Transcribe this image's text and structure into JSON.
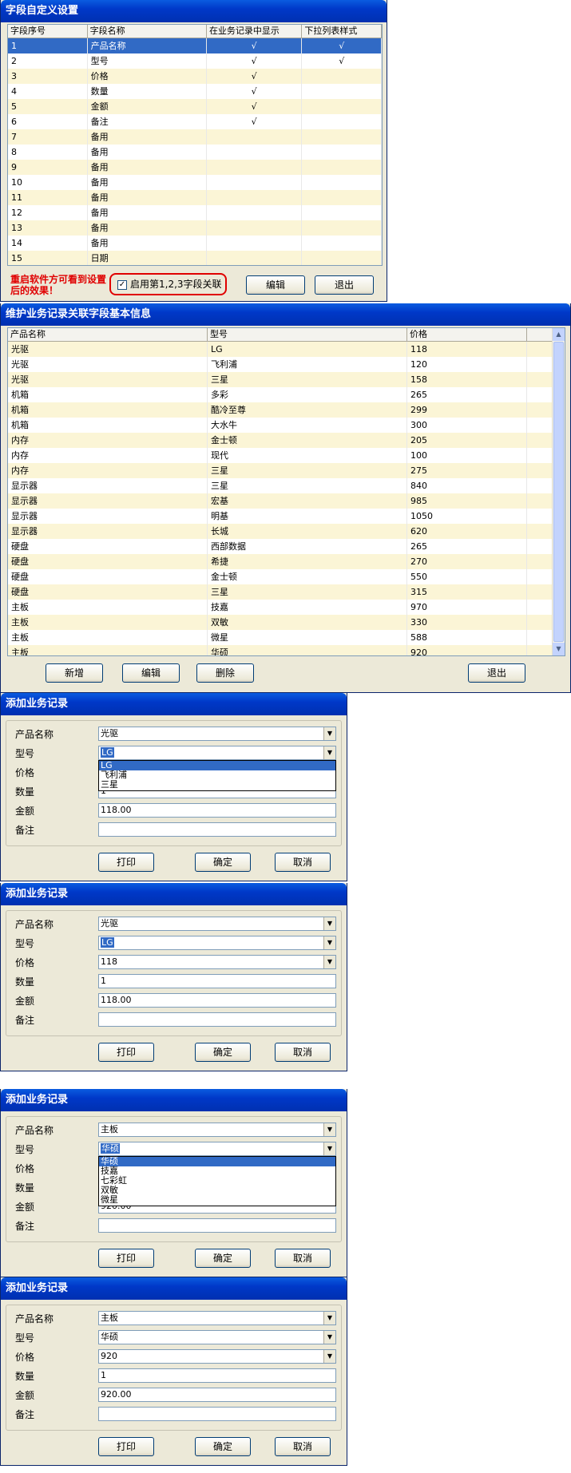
{
  "win1": {
    "title": "字段自定义设置",
    "headers": [
      "字段序号",
      "字段名称",
      "在业务记录中显示",
      "下拉列表样式"
    ],
    "rows": [
      [
        "1",
        "产品名称",
        "√",
        "√"
      ],
      [
        "2",
        "型号",
        "√",
        "√"
      ],
      [
        "3",
        "价格",
        "√",
        ""
      ],
      [
        "4",
        "数量",
        "√",
        ""
      ],
      [
        "5",
        "金额",
        "√",
        ""
      ],
      [
        "6",
        "备注",
        "√",
        ""
      ],
      [
        "7",
        "备用",
        "",
        ""
      ],
      [
        "8",
        "备用",
        "",
        ""
      ],
      [
        "9",
        "备用",
        "",
        ""
      ],
      [
        "10",
        "备用",
        "",
        ""
      ],
      [
        "11",
        "备用",
        "",
        ""
      ],
      [
        "12",
        "备用",
        "",
        ""
      ],
      [
        "13",
        "备用",
        "",
        ""
      ],
      [
        "14",
        "备用",
        "",
        ""
      ],
      [
        "15",
        "日期",
        "",
        ""
      ]
    ],
    "note": "重启软件方可看到设置后的效果！",
    "checkbox": "启用第1,2,3字段关联",
    "checked": "✓",
    "edit": "编辑",
    "exit": "退出"
  },
  "win2": {
    "title": "维护业务记录关联字段基本信息",
    "headers": [
      "产品名称",
      "型号",
      "价格"
    ],
    "rows": [
      [
        "光驱",
        "LG",
        "118"
      ],
      [
        "光驱",
        "飞利浦",
        "120"
      ],
      [
        "光驱",
        "三星",
        "158"
      ],
      [
        "机箱",
        "多彩",
        "265"
      ],
      [
        "机箱",
        "酷冷至尊",
        "299"
      ],
      [
        "机箱",
        "大水牛",
        "300"
      ],
      [
        "内存",
        "金士顿",
        "205"
      ],
      [
        "内存",
        "现代",
        "100"
      ],
      [
        "内存",
        "三星",
        "275"
      ],
      [
        "显示器",
        "三星",
        "840"
      ],
      [
        "显示器",
        "宏基",
        "985"
      ],
      [
        "显示器",
        "明基",
        "1050"
      ],
      [
        "显示器",
        "长城",
        "620"
      ],
      [
        "硬盘",
        "西部数据",
        "265"
      ],
      [
        "硬盘",
        "希捷",
        "270"
      ],
      [
        "硬盘",
        "金士顿",
        "550"
      ],
      [
        "硬盘",
        "三星",
        "315"
      ],
      [
        "主板",
        "技嘉",
        "970"
      ],
      [
        "主板",
        "双敏",
        "330"
      ],
      [
        "主板",
        "微星",
        "588"
      ],
      [
        "主板",
        "华硕",
        "920"
      ]
    ],
    "add": "新增",
    "edit": "编辑",
    "del": "删除",
    "exit": "退出"
  },
  "labels": [
    "产品名称",
    "型号",
    "价格",
    "数量",
    "金额",
    "备注"
  ],
  "dlgs": [
    {
      "title": "添加业务记录",
      "v": [
        "光驱",
        "LG",
        "",
        "1",
        "118.00",
        ""
      ],
      "list": [
        "LG",
        "飞利浦",
        "三星"
      ]
    },
    {
      "title": "添加业务记录",
      "v": [
        "光驱",
        "LG",
        "118",
        "1",
        "118.00",
        ""
      ]
    },
    {
      "title": "添加业务记录",
      "v": [
        "主板",
        "华硕",
        "",
        "",
        "920.00",
        ""
      ],
      "list": [
        "华硕",
        "技嘉",
        "七彩虹",
        "双敏",
        "微星"
      ]
    },
    {
      "title": "添加业务记录",
      "v": [
        "主板",
        "华硕",
        "920",
        "1",
        "920.00",
        ""
      ]
    }
  ],
  "btns": {
    "print": "打印",
    "ok": "确定",
    "cancel": "取消"
  },
  "icons": {
    "dropdown": "▼",
    "scroll_up": "▲",
    "scroll_down": "▼"
  }
}
